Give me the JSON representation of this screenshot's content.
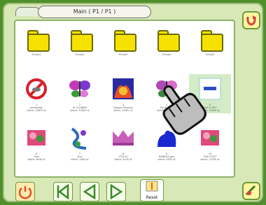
{
  "header": {
    "title": "Main ( P1 / P1 )"
  },
  "grid": {
    "rows": [
      [
        {
          "kind": "folder",
          "caption": "Group1"
        },
        {
          "kind": "folder",
          "caption": "Group2"
        },
        {
          "kind": "folder",
          "caption": "Group3"
        },
        {
          "kind": "folder",
          "caption": "Group4"
        },
        {
          "kind": "folder",
          "caption": "Group5"
        }
      ],
      [
        {
          "kind": "no-symbol",
          "caption": "1\nembroider\nstitch: 10674 st"
        },
        {
          "kind": "butterfly",
          "caption": "2\nM. FLOWER\nstitch: 10052 st"
        },
        {
          "kind": "dragon",
          "caption": "3\nDragon Phoenix\nstitch: 10051 st"
        },
        {
          "kind": "butterfly2",
          "caption": "4\nMy Flower\nstitch: 10060 st"
        },
        {
          "kind": "selected",
          "caption": "5\nFLW 2.DST\nstitch: 11535 st"
        }
      ],
      [
        {
          "kind": "flower",
          "caption": "6\nflow\nstitch: 6045 st"
        },
        {
          "kind": "vine",
          "caption": "7\nvine\nstitch: 5004 st"
        },
        {
          "kind": "crown",
          "caption": "8\nCTN 01\nstitch: 6145 st"
        },
        {
          "kind": "blue-blob",
          "caption": "9\nRMD001.pat\nstitch: 9932 st"
        },
        {
          "kind": "flower2",
          "caption": "10\nFLW 2.DST\nstitch: 11535 st"
        }
      ]
    ]
  },
  "bottom": {
    "reset_label": "Reset"
  },
  "colors": {
    "bg_green": "#4f8f2c",
    "screen": "#d8e8b6",
    "folder": "#f5e200",
    "selected": "#d3ebc7"
  }
}
